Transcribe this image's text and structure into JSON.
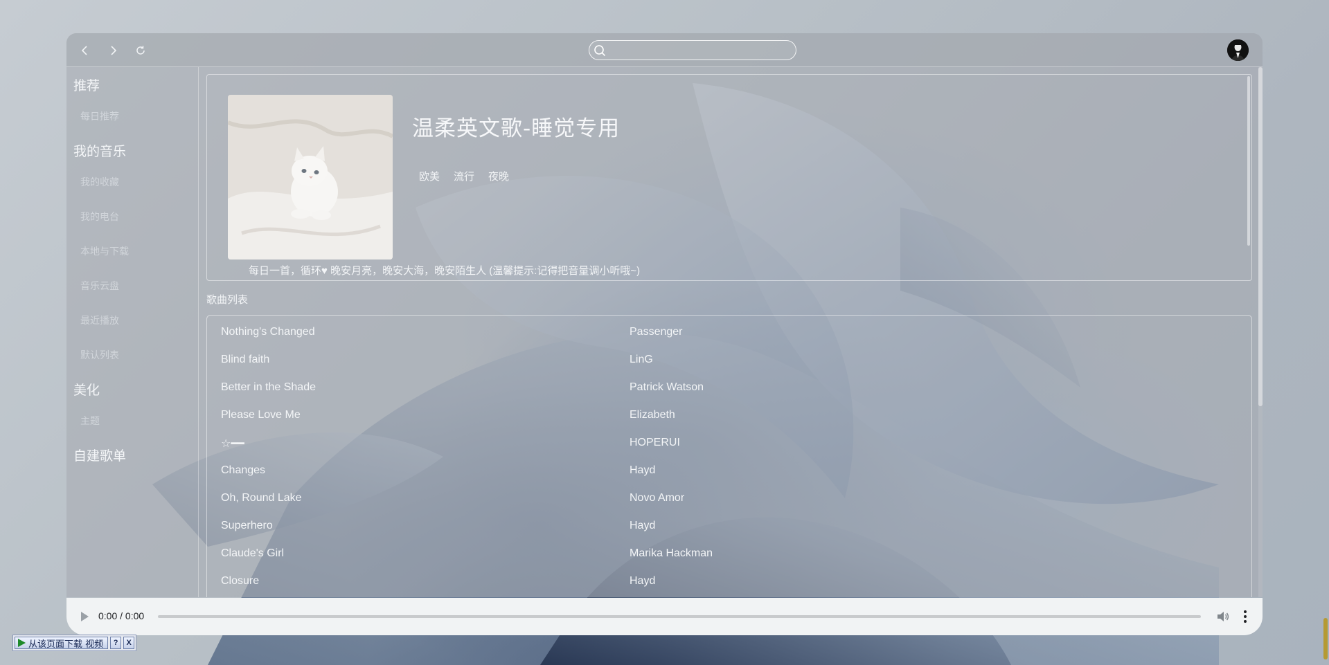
{
  "search": {
    "placeholder": ""
  },
  "sidebar": {
    "sections": [
      {
        "title": "推荐",
        "items": [
          "每日推荐"
        ]
      },
      {
        "title": "我的音乐",
        "items": [
          "我的收藏",
          "我的电台",
          "本地与下载",
          "音乐云盘",
          "最近播放",
          "默认列表"
        ]
      },
      {
        "title": "美化",
        "items": [
          "主题"
        ]
      },
      {
        "title": "自建歌单",
        "items": []
      }
    ]
  },
  "playlist": {
    "title": "温柔英文歌-睡觉专用",
    "tags": [
      "欧美",
      "流行",
      "夜晚"
    ],
    "description": "每日一首，循环♥ 晚安月亮，晚安大海，晚安陌生人  (温馨提示:记得把音量调小听哦~)"
  },
  "song_list": {
    "title": "歌曲列表",
    "songs": [
      {
        "name": "Nothing's Changed",
        "artist": "Passenger"
      },
      {
        "name": "Blind faith",
        "artist": "LinG"
      },
      {
        "name": "Better in the Shade",
        "artist": "Patrick Watson"
      },
      {
        "name": "Please Love Me",
        "artist": "Elizabeth"
      },
      {
        "name": "☆━━",
        "artist": "HOPERUI"
      },
      {
        "name": "Changes",
        "artist": "Hayd"
      },
      {
        "name": "Oh, Round Lake",
        "artist": "Novo Amor"
      },
      {
        "name": "Superhero",
        "artist": "Hayd"
      },
      {
        "name": "Claude's Girl",
        "artist": "Marika Hackman"
      },
      {
        "name": "Closure",
        "artist": "Hayd"
      }
    ]
  },
  "player": {
    "time": "0:00 / 0:00",
    "progress": 0
  },
  "download_bar": {
    "label": "从该页面下载 视频",
    "help": "?",
    "close": "X"
  },
  "colors": {
    "text": "#f3f5f7",
    "player_bg": "#f1f3f4",
    "accent_border": "#ffffff"
  }
}
